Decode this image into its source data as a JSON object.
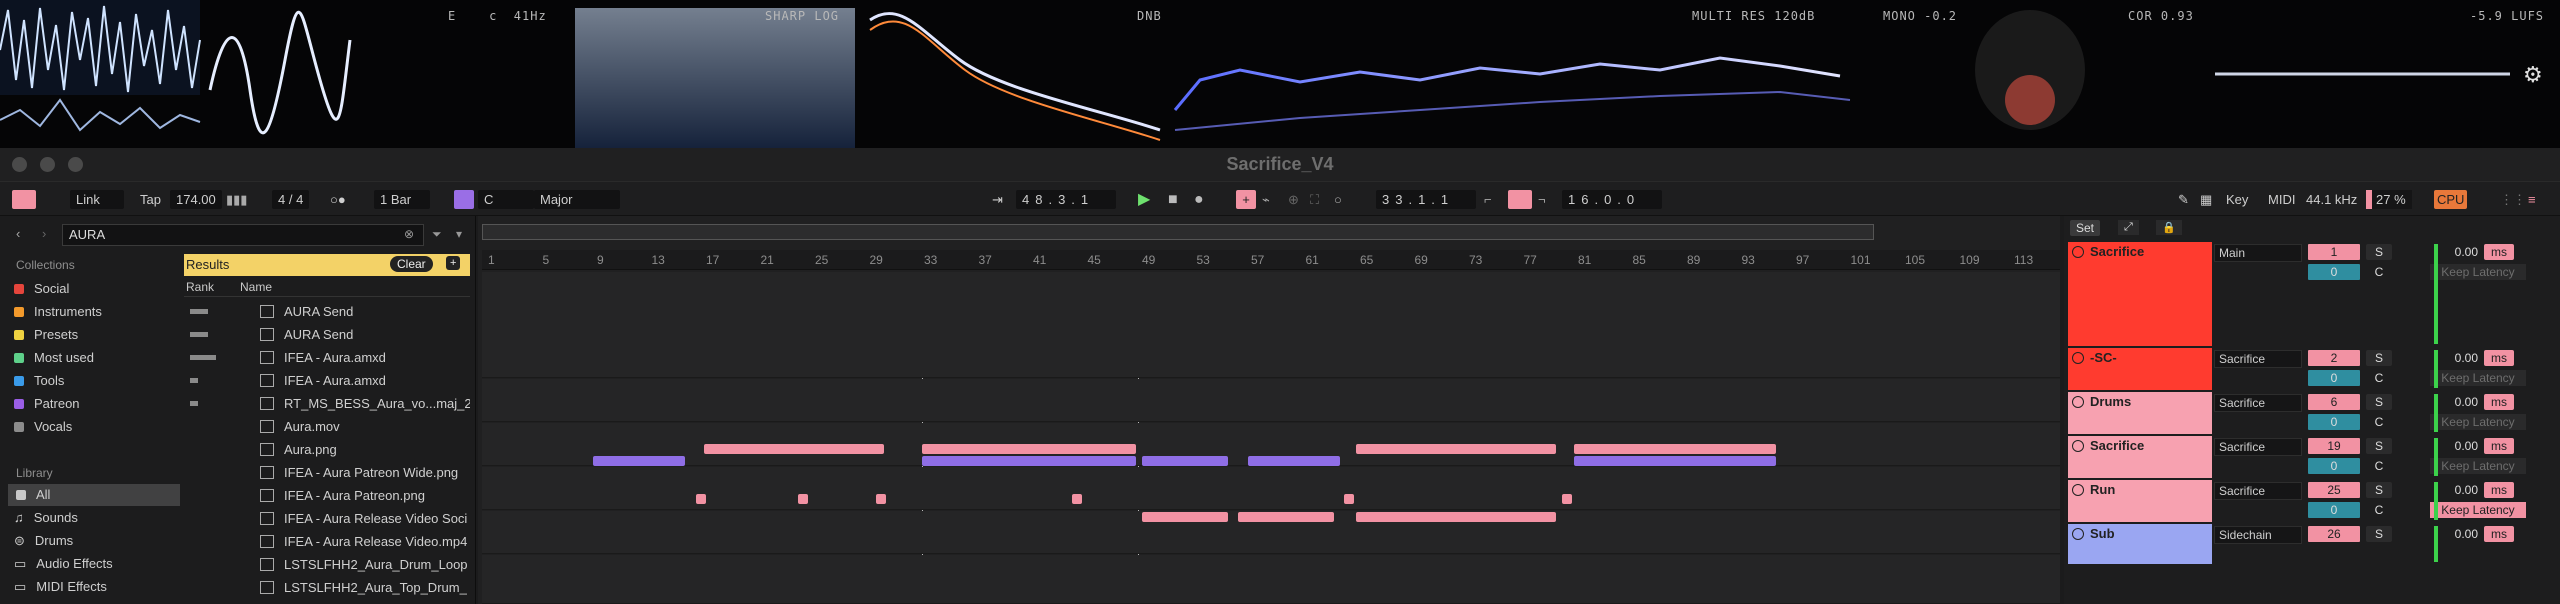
{
  "visualizers": {
    "labels": [
      "E    c  41Hz",
      "SHARP LOG",
      "DNB",
      "MULTI RES 120dB",
      "MONO -0.2",
      "COR 0.93",
      "-5.9 LUFS"
    ],
    "icon": "gear-icon"
  },
  "window": {
    "title": "Sacrifice_V4"
  },
  "transport": {
    "link": "Link",
    "tap": "Tap",
    "tempo": "174.00",
    "signature": "4 / 4",
    "metro": "○●",
    "quantize": "1 Bar",
    "key_root": "C",
    "scale": "Major",
    "position": [
      "48.",
      "3.",
      "1"
    ],
    "loop_start": [
      "33.",
      "1.",
      "1"
    ],
    "loop_length": [
      "16.",
      "0.",
      "0"
    ],
    "key": "Key",
    "midi": "MIDI",
    "sample_rate": "44.1 kHz",
    "cpu_percent": "27 %",
    "cpu": "CPU"
  },
  "browser": {
    "search_value": "AURA",
    "collections_header": "Collections",
    "collections": [
      {
        "label": "Social",
        "color": "#e5453c"
      },
      {
        "label": "Instruments",
        "color": "#f39a2c"
      },
      {
        "label": "Presets",
        "color": "#efd241"
      },
      {
        "label": "Most used",
        "color": "#5ed08a"
      },
      {
        "label": "Tools",
        "color": "#3a9bea"
      },
      {
        "label": "Patreon",
        "color": "#9a5ee6"
      },
      {
        "label": "Vocals",
        "color": "#8c8c8c"
      }
    ],
    "library_header": "Library",
    "library": [
      "All",
      "Sounds",
      "Drums",
      "Audio Effects",
      "MIDI Effects"
    ],
    "results_label": "Results",
    "clear": "Clear",
    "col_rank": "Rank",
    "col_name": "Name",
    "results": [
      "AURA Send",
      "AURA Send",
      "IFEA - Aura.amxd",
      "IFEA - Aura.amxd",
      "RT_MS_BESS_Aura_vo...maj_2",
      "Aura.mov",
      "Aura.png",
      "IFEA - Aura Patreon Wide.png",
      "IFEA - Aura Patreon.png",
      "IFEA - Aura Release Video Soci",
      "IFEA - Aura Release Video.mp4",
      "LSTSLFHH2_Aura_Drum_Loop",
      "LSTSLFHH2_Aura_Top_Drum_"
    ]
  },
  "arrangement": {
    "bars": [
      "1",
      "5",
      "9",
      "13",
      "17",
      "21",
      "25",
      "29",
      "33",
      "37",
      "41",
      "45",
      "49",
      "53",
      "57",
      "61",
      "65",
      "69",
      "73",
      "77",
      "81",
      "85",
      "89",
      "93",
      "97",
      "101",
      "105",
      "109",
      "113"
    ]
  },
  "mixer": {
    "set": "Set",
    "tracks": [
      {
        "name": "Sacrifice",
        "color": "#ff3b2f",
        "route": "Main",
        "num": "1",
        "s": "S",
        "vol": "0.00",
        "unit": "ms",
        "pan": "0",
        "c": "C",
        "latency": "Keep Latency"
      },
      {
        "name": "-SC-",
        "color": "#ff3b2f",
        "route": "Sacrifice",
        "num": "2",
        "s": "S",
        "vol": "0.00",
        "unit": "ms",
        "pan": "0",
        "c": "C",
        "latency": "Keep Latency"
      },
      {
        "name": "Drums",
        "color": "#f7a1b0",
        "route": "Sacrifice",
        "num": "6",
        "s": "S",
        "vol": "0.00",
        "unit": "ms",
        "pan": "0",
        "c": "C",
        "latency": "Keep Latency"
      },
      {
        "name": "Sacrifice",
        "color": "#f7a1b0",
        "route": "Sacrifice",
        "num": "19",
        "s": "S",
        "vol": "0.00",
        "unit": "ms",
        "pan": "0",
        "c": "C",
        "latency": "Keep Latency"
      },
      {
        "name": "Run",
        "color": "#f7a1b0",
        "route": "Sacrifice",
        "num": "25",
        "s": "S",
        "vol": "0.00",
        "unit": "ms",
        "pan": "0",
        "c": "C",
        "latency": "Keep Latency"
      },
      {
        "name": "Sub",
        "color": "#9aa6f2",
        "route": "Sidechain",
        "num": "26",
        "s": "S",
        "vol": "0.00",
        "unit": "ms"
      }
    ]
  }
}
